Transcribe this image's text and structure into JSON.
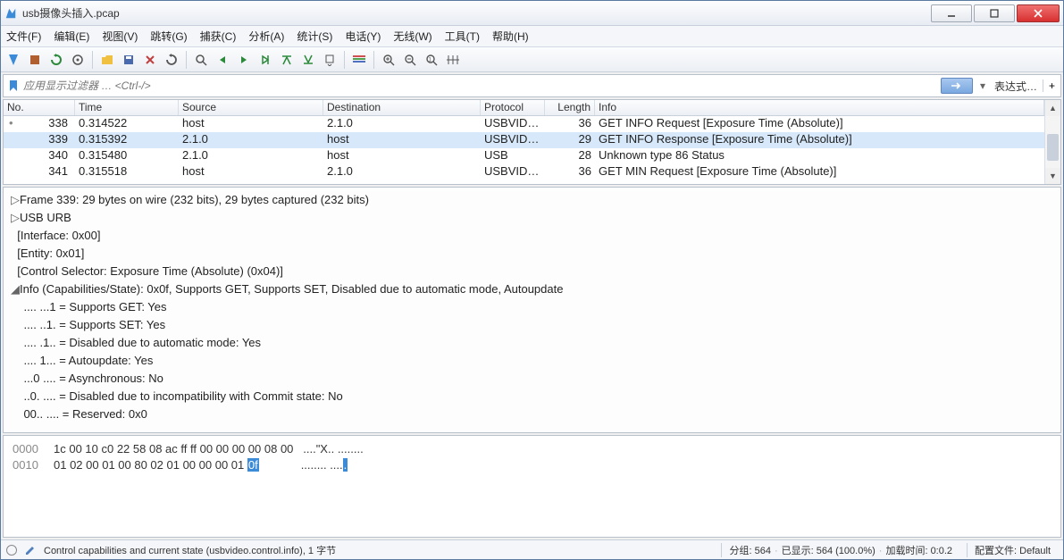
{
  "window": {
    "title": "usb摄像头插入.pcap"
  },
  "menu": {
    "file": "文件(F)",
    "edit": "编辑(E)",
    "view": "视图(V)",
    "go": "跳转(G)",
    "capture": "捕获(C)",
    "analyze": "分析(A)",
    "stats": "统计(S)",
    "telephony": "电话(Y)",
    "wireless": "无线(W)",
    "tools": "工具(T)",
    "help": "帮助(H)"
  },
  "filter": {
    "placeholder": "应用显示过滤器 … <Ctrl-/>",
    "expression": "表达式…",
    "plus": "+"
  },
  "columns": {
    "no": "No.",
    "time": "Time",
    "src": "Source",
    "dst": "Destination",
    "proto": "Protocol",
    "len": "Length",
    "info": "Info"
  },
  "packets": [
    {
      "no": "338",
      "time": "0.314522",
      "src": "host",
      "dst": "2.1.0",
      "proto": "USBVID…",
      "len": "36",
      "info": "GET INFO Request  [Exposure Time (Absolute)]",
      "dot": true
    },
    {
      "no": "339",
      "time": "0.315392",
      "src": "2.1.0",
      "dst": "host",
      "proto": "USBVID…",
      "len": "29",
      "info": "GET INFO Response [Exposure Time (Absolute)]",
      "sel": true
    },
    {
      "no": "340",
      "time": "0.315480",
      "src": "2.1.0",
      "dst": "host",
      "proto": "USB",
      "len": "28",
      "info": "Unknown type 86 Status"
    },
    {
      "no": "341",
      "time": "0.315518",
      "src": "host",
      "dst": "2.1.0",
      "proto": "USBVID…",
      "len": "36",
      "info": "GET MIN Request  [Exposure Time (Absolute)]"
    }
  ],
  "details": {
    "l0": "Frame 339: 29 bytes on wire (232 bits), 29 bytes captured (232 bits)",
    "l1": "USB URB",
    "l2": "[Interface: 0x00]",
    "l3": "[Entity: 0x01]",
    "l4": "[Control Selector: Exposure Time (Absolute) (0x04)]",
    "l5": "Info (Capabilities/State): 0x0f, Supports GET, Supports SET, Disabled due to automatic mode, Autoupdate",
    "b0": ".... ...1 = Supports GET: Yes",
    "b1": ".... ..1. = Supports SET: Yes",
    "b2": ".... .1.. = Disabled due to automatic mode: Yes",
    "b3": ".... 1... = Autoupdate: Yes",
    "b4": "...0 .... = Asynchronous: No",
    "b5": "..0. .... = Disabled due to incompatibility with Commit state: No",
    "b6": "00.. .... = Reserved: 0x0"
  },
  "hex": {
    "o0": "0000",
    "h0": "1c 00 10 c0 22 58 08 ac  ff ff 00 00 00 00 08 00",
    "a0": "....\"X.. ........",
    "o1": "0010",
    "h1": "01 02 00 01 00 80 02 01  00 00 00 01 ",
    "hl": "0f",
    "a1": "........ ....",
    "a1hl": "."
  },
  "status": {
    "desc": "Control capabilities and current state (usbvideo.control.info), 1 字节",
    "pkts": "分组: 564",
    "disp": "已显示: 564 (100.0%)",
    "load": "加载时间: 0:0.2",
    "profile": "配置文件: Default"
  }
}
